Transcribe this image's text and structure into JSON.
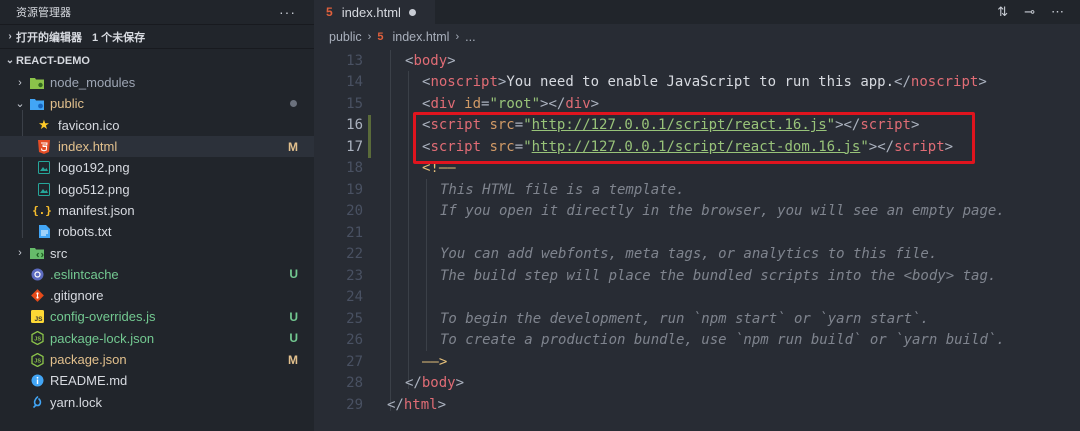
{
  "sidebar": {
    "title": "资源管理器",
    "more": "···",
    "open_editors": {
      "label": "打开的编辑器",
      "unsaved": "1 个未保存"
    },
    "project": "REACT-DEMO",
    "items": [
      {
        "label": "node_modules",
        "icon": "folder-node-icon",
        "status": ""
      },
      {
        "label": "public",
        "icon": "folder-public-icon",
        "status": ""
      },
      {
        "label": "favicon.ico",
        "icon": "star-icon",
        "status": ""
      },
      {
        "label": "index.html",
        "icon": "html-file-icon",
        "status": "M"
      },
      {
        "label": "logo192.png",
        "icon": "image-file-icon",
        "status": ""
      },
      {
        "label": "logo512.png",
        "icon": "image-file-icon",
        "status": ""
      },
      {
        "label": "manifest.json",
        "icon": "json-file-icon",
        "status": ""
      },
      {
        "label": "robots.txt",
        "icon": "text-file-icon",
        "status": ""
      },
      {
        "label": "src",
        "icon": "folder-src-icon",
        "status": ""
      },
      {
        "label": ".eslintcache",
        "icon": "eslint-file-icon",
        "status": "U"
      },
      {
        "label": ".gitignore",
        "icon": "git-file-icon",
        "status": ""
      },
      {
        "label": "config-overrides.js",
        "icon": "js-file-icon",
        "status": "U"
      },
      {
        "label": "package-lock.json",
        "icon": "npm-file-icon",
        "status": "U"
      },
      {
        "label": "package.json",
        "icon": "npm-file-icon",
        "status": "M"
      },
      {
        "label": "README.md",
        "icon": "info-file-icon",
        "status": ""
      },
      {
        "label": "yarn.lock",
        "icon": "yarn-file-icon",
        "status": ""
      }
    ]
  },
  "editor": {
    "tab": {
      "label": "index.html",
      "icon": "html-file-icon"
    },
    "breadcrumb": {
      "folder": "public",
      "file": "index.html",
      "rest": "..."
    },
    "lines": {
      "n13": "13",
      "n14": "14",
      "n15": "15",
      "n16": "16",
      "n17": "17",
      "n18": "18",
      "n19": "19",
      "n20": "20",
      "n21": "21",
      "n22": "22",
      "n23": "23",
      "n24": "24",
      "n25": "25",
      "n26": "26",
      "n27": "27",
      "n28": "28",
      "n29": "29",
      "noscript_text": "You need to enable JavaScript to run this app.",
      "root_id": "\"root\"",
      "react_url": "http://127.0.0.1/script/react.16.js",
      "react_dom_url": "http://127.0.0.1/script/react-dom.16.js",
      "c19": "This HTML file is a template.",
      "c20": "If you open it directly in the browser, you will see an empty page.",
      "c22": "You can add webfonts, meta tags, or analytics to this file.",
      "c23": "The build step will place the bundled scripts into the <body> tag.",
      "c25": "To begin the development, run `npm start` or `yarn start`.",
      "c26": "To create a production bundle, use `npm run build` or `yarn build`."
    }
  },
  "colors": {
    "highlight": "#e0141e",
    "modified": "#e2c08d",
    "untracked": "#73c991"
  }
}
